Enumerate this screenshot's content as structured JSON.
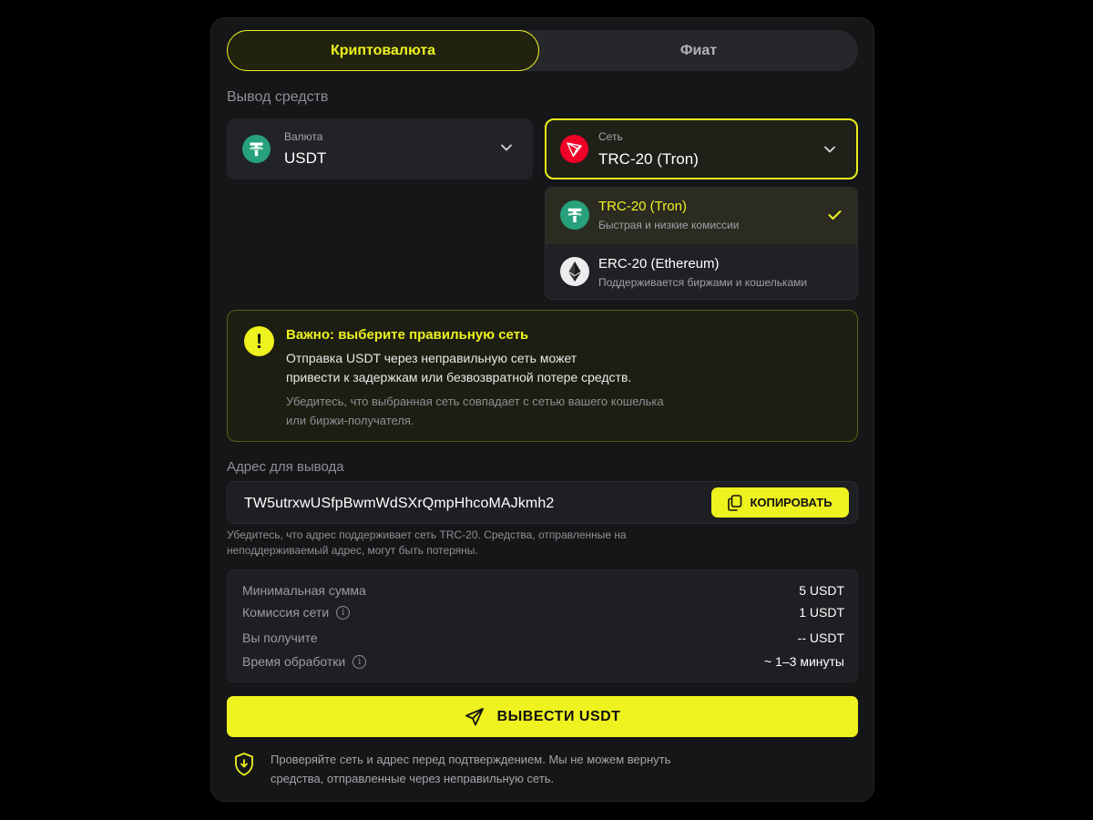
{
  "tabs": {
    "crypto": "Криптовалюта",
    "fiat": "Фиат"
  },
  "section_title": "Вывод средств",
  "currency": {
    "caption": "Валюта",
    "value": "USDT"
  },
  "network": {
    "caption": "Сеть",
    "value": "TRC-20 (Tron)"
  },
  "network_options": [
    {
      "title": "TRC-20 (Tron)",
      "subtitle": "Быстрая и низкие комиссии",
      "selected": true
    },
    {
      "title": "ERC-20 (Ethereum)",
      "subtitle": "Поддерживается биржами и кошельками",
      "selected": false
    }
  ],
  "warning": {
    "title": "Важно: выберите правильную сеть",
    "body_line1": "Отправка USDT через неправильную сеть может",
    "body_line2": "привести к задержкам или безвозвратной потере средств.",
    "note_line1": "Убедитесь, что выбранная сеть совпадает с сетью вашего кошелька",
    "note_line2": "или биржи-получателя."
  },
  "address": {
    "label": "Адрес для вывода",
    "value": "TW5utrxwUSfpBwmWdSXrQmpHhcoMAJkmh2",
    "copy_label": "КОПИРОВАТЬ",
    "hint_line1": "Убедитесь, что адрес поддерживает сеть TRC-20. Средства, отправленные на",
    "hint_line2": "неподдерживаемый адрес, могут быть потеряны."
  },
  "info": {
    "min_label": "Минимальная сумма",
    "min_value": "5 USDT",
    "fee_label": "Комиссия сети",
    "fee_value": "1 USDT",
    "receive_label": "Вы получите",
    "receive_value": "-- USDT",
    "time_label": "Время обработки",
    "time_value": "~ 1–3 минуты"
  },
  "submit_label": "ВЫВЕСТИ USDT",
  "footer": {
    "line1": "Проверяйте сеть и адрес перед подтверждением. Мы не можем вернуть",
    "line2": "средства, отправленные через неправильную сеть."
  },
  "colors": {
    "accent": "#eef21e",
    "tether": "#26a17b",
    "tron": "#ef0027",
    "background": "#151617"
  },
  "icons": [
    "tether-icon",
    "tron-icon",
    "ethereum-icon",
    "chevron-down-icon",
    "check-icon",
    "exclamation-icon",
    "clipboard-icon",
    "info-icon",
    "send-icon",
    "shield-icon"
  ]
}
